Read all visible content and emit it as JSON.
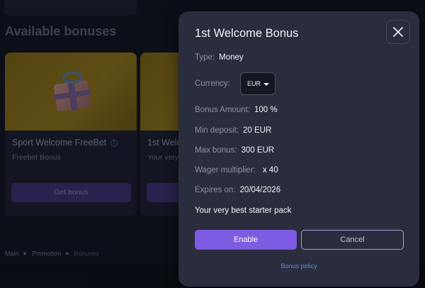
{
  "background": {
    "section_title": "Available bonuses",
    "cards": [
      {
        "title": "Sport Welcome FreeBet",
        "subtitle": "Freebet Bonus",
        "button_label": "Get bonus",
        "info_icon": "info-icon"
      },
      {
        "title": "1st Welco",
        "subtitle": "Your very",
        "button_label": ""
      }
    ],
    "breadcrumb": {
      "items": [
        "Main",
        "Promotion",
        "Bonuses"
      ],
      "separator_icon": "chevron-right-icon"
    }
  },
  "modal": {
    "title": "1st Welcome Bonus",
    "close_icon": "close-icon",
    "type": {
      "label": "Type:",
      "value": "Money"
    },
    "currency": {
      "label": "Currency:",
      "selected": "EUR",
      "caret_icon": "caret-down-icon"
    },
    "bonus_amount": {
      "label": "Bonus Amount:",
      "value": "100 %"
    },
    "min_deposit": {
      "label": "Min deposit:",
      "value": "20 EUR"
    },
    "max_bonus": {
      "label": "Max bonus:",
      "value": "300 EUR"
    },
    "wager_multiplier": {
      "label": "Wager multiplier:",
      "value": "x 40"
    },
    "expires_on": {
      "label": "Expires on:",
      "value": "20/04/2026"
    },
    "description": "Your very best starter pack",
    "enable_label": "Enable",
    "cancel_label": "Cancel",
    "policy_link": "Bonus policy"
  },
  "colors": {
    "accent": "#7c5ce0",
    "link": "#5d8bd6",
    "modal_bg": "#2a2d3d",
    "card_banner": "#8b7317"
  }
}
